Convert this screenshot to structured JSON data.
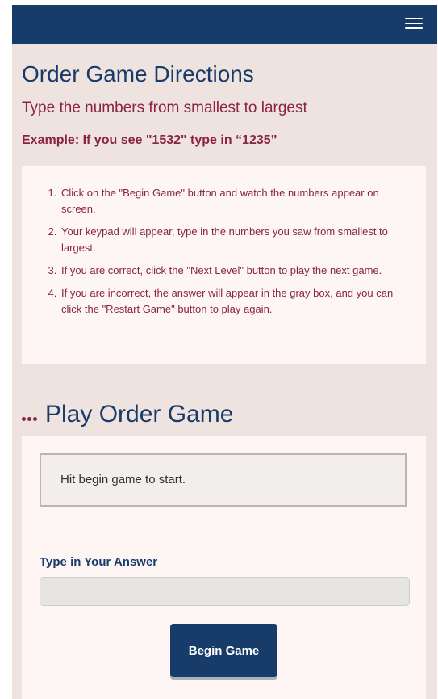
{
  "header": {
    "menu_icon": "hamburger-menu-icon",
    "bar_color": "#183c6a"
  },
  "directions": {
    "title": "Order Game Directions",
    "subtitle": "Type the numbers from smallest to largest",
    "example": "Example: If you see \"1532\" type in “1235”",
    "steps": [
      "Click on the \"Begin Game\" button and watch the numbers appear on screen.",
      "Your keypad will appear, type in the numbers you saw from smallest to largest.",
      "If you are correct, click the \"Next Level\" button to play the next game.",
      "If you are incorrect, the answer will appear in the gray box, and you can click the \"Restart Game\" button to play again."
    ]
  },
  "play": {
    "title": "Play Order Game",
    "title_icon": "three-dots-icon",
    "display_text": "Hit begin game to start.",
    "answer_label": "Type in Your Answer",
    "answer_value": "",
    "begin_label": "Begin Game"
  },
  "colors": {
    "navy": "#183c6a",
    "maroon": "#8a2344",
    "background": "#efe3df",
    "card": "#fdf6f5"
  }
}
